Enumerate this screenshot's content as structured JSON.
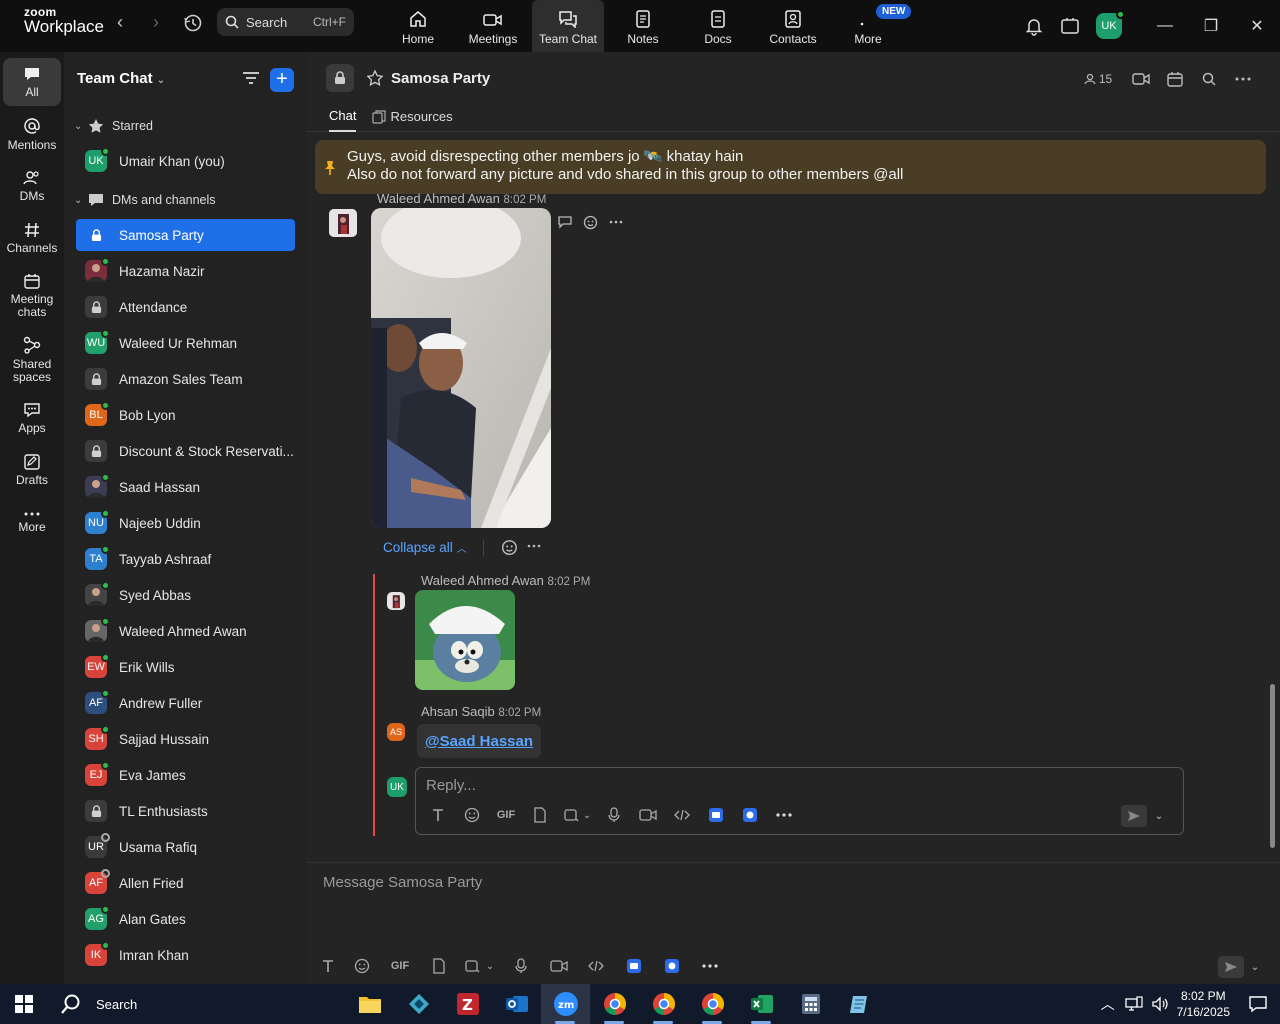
{
  "topbar": {
    "logo_top": "zoom",
    "logo_bottom": "Workplace",
    "search_label": "Search",
    "search_shortcut": "Ctrl+F",
    "tabs": [
      {
        "label": "Home",
        "icon": "home-icon"
      },
      {
        "label": "Meetings",
        "icon": "video-icon"
      },
      {
        "label": "Team Chat",
        "icon": "chat-icon",
        "active": true
      },
      {
        "label": "Notes",
        "icon": "notes-icon"
      },
      {
        "label": "Docs",
        "icon": "docs-icon"
      },
      {
        "label": "Contacts",
        "icon": "contacts-icon"
      },
      {
        "label": "More",
        "icon": "more-icon"
      }
    ],
    "new_badge": "NEW",
    "user_initials": "UK"
  },
  "rail": [
    {
      "label": "All",
      "icon": "chat-bubble-icon"
    },
    {
      "label": "Mentions",
      "icon": "at-icon"
    },
    {
      "label": "DMs",
      "icon": "people-icon"
    },
    {
      "label": "Channels",
      "icon": "hash-icon"
    },
    {
      "label": "Meeting chats",
      "icon": "calendar-icon"
    },
    {
      "label": "Shared spaces",
      "icon": "shared-icon"
    },
    {
      "label": "Apps",
      "icon": "apps-icon"
    },
    {
      "label": "Drafts",
      "icon": "drafts-icon"
    },
    {
      "label": "More",
      "icon": "ellipsis-icon"
    }
  ],
  "sidebar": {
    "title": "Team Chat",
    "starred_label": "Starred",
    "dms_label": "DMs and channels",
    "starred": [
      {
        "label": "Umair Khan (you)",
        "initials": "UK",
        "color": "#1e9e6a"
      }
    ],
    "items": [
      {
        "label": "Samosa Party",
        "type": "lock"
      },
      {
        "label": "Hazama Nazir",
        "type": "photo",
        "color": "#7a2d3a"
      },
      {
        "label": "Attendance",
        "type": "lock"
      },
      {
        "label": "Waleed Ur Rehman",
        "type": "initials",
        "initials": "WU",
        "color": "#22a06b"
      },
      {
        "label": "Amazon Sales Team",
        "type": "lock"
      },
      {
        "label": "Bob Lyon",
        "type": "initials",
        "initials": "BL",
        "color": "#e0661a"
      },
      {
        "label": "Discount & Stock Reservati...",
        "type": "lock"
      },
      {
        "label": "Saad Hassan",
        "type": "photo",
        "color": "#3c3c55"
      },
      {
        "label": "Najeeb Uddin",
        "type": "initials",
        "initials": "NU",
        "color": "#2f7fd1"
      },
      {
        "label": "Tayyab Ashraaf",
        "type": "initials",
        "initials": "TA",
        "color": "#2f7fd1"
      },
      {
        "label": "Syed Abbas",
        "type": "photo",
        "color": "#444"
      },
      {
        "label": "Waleed Ahmed Awan",
        "type": "photo",
        "color": "#666"
      },
      {
        "label": "Erik Wills",
        "type": "initials",
        "initials": "EW",
        "color": "#d8433a"
      },
      {
        "label": "Andrew Fuller",
        "type": "initials",
        "initials": "AF",
        "color": "#2d4f80"
      },
      {
        "label": "Sajjad Hussain",
        "type": "initials",
        "initials": "SH",
        "color": "#d8433a"
      },
      {
        "label": "Eva James",
        "type": "initials",
        "initials": "EJ",
        "color": "#d8433a"
      },
      {
        "label": "TL Enthusiasts",
        "type": "lock"
      },
      {
        "label": "Usama Rafiq",
        "type": "initials",
        "initials": "UR",
        "color": "#3a3a3a",
        "offline": true
      },
      {
        "label": "Allen Fried",
        "type": "initials",
        "initials": "AF",
        "color": "#d8433a",
        "offline": true
      },
      {
        "label": "Alan Gates",
        "type": "initials",
        "initials": "AG",
        "color": "#22a06b"
      },
      {
        "label": "Imran Khan",
        "type": "initials",
        "initials": "IK",
        "color": "#d8433a"
      }
    ]
  },
  "channel": {
    "title": "Samosa Party",
    "member_count": "15",
    "tab_chat": "Chat",
    "tab_resources": "Resources",
    "pinned_line1": "Guys, avoid disrespecting other members jo 🛰️ khatay hain",
    "pinned_line2": "Also do not forward any picture and vdo shared in this group to other members @all"
  },
  "messages": {
    "m1_sender": "Waleed Ahmed Awan",
    "m1_time": "8:02 PM",
    "collapse_label": "Collapse all",
    "m2_sender": "Waleed Ahmed Awan",
    "m2_time": "8:02 PM",
    "m3_sender": "Ahsan Saqib",
    "m3_time": "8:02 PM",
    "m3_initials": "AS",
    "m3_mention": "@Saad Hassan",
    "reply_placeholder": "Reply...",
    "reply_initials": "UK"
  },
  "compose": {
    "placeholder": "Message Samosa Party",
    "gif_label": "GIF"
  },
  "taskbar": {
    "search_label": "Search",
    "time": "8:02 PM",
    "date": "7/16/2025"
  }
}
